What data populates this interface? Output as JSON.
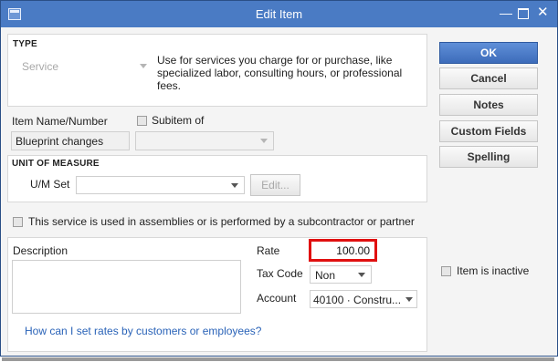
{
  "window": {
    "title": "Edit Item"
  },
  "type_section": {
    "heading": "TYPE",
    "selected": "Service",
    "description_line1": "Use for services you charge for or purchase, like",
    "description_line2": "specialized labor, consulting hours, or professional",
    "description_line3": "fees."
  },
  "item": {
    "name_label": "Item Name/Number",
    "name_value": "Blueprint changes",
    "subitem_label": "Subitem of",
    "subitem_value": ""
  },
  "unit_of_measure": {
    "heading": "UNIT OF MEASURE",
    "um_set_label": "U/M Set",
    "um_set_value": "",
    "edit_label": "Edit..."
  },
  "assemblies": {
    "label": "This service is used in assemblies or is performed by a subcontractor or partner"
  },
  "details": {
    "description_label": "Description",
    "description_value": "",
    "rate_label": "Rate",
    "rate_value": "100.00",
    "taxcode_label": "Tax Code",
    "taxcode_value": "Non",
    "account_label": "Account",
    "account_value": "40100 · Constru..."
  },
  "help_link": "How can I set rates by customers or employees?",
  "buttons": {
    "ok": "OK",
    "cancel": "Cancel",
    "notes": "Notes",
    "custom_fields": "Custom Fields",
    "spelling": "Spelling"
  },
  "inactive": {
    "label": "Item is inactive"
  },
  "colors": {
    "titlebar": "#4a7bc4",
    "primary_button": "#3d6cba",
    "highlight": "#e01010",
    "link": "#2a63b8"
  }
}
